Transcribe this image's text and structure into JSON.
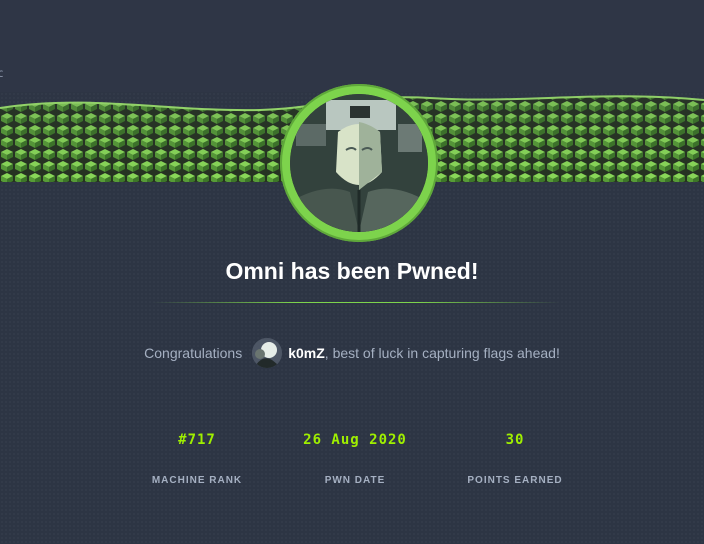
{
  "header": {
    "corner_text": "C"
  },
  "banner": {
    "accent_color": "#7dd34c",
    "avatar_icon": "robot-face-icon"
  },
  "title": "Omni has been Pwned!",
  "message": {
    "prefix": "Congratulations",
    "username": "k0mZ",
    "suffix": ", best of luck in capturing flags ahead!"
  },
  "stats": [
    {
      "value": "#717",
      "label": "MACHINE RANK"
    },
    {
      "value": "26 Aug 2020",
      "label": "PWN DATE"
    },
    {
      "value": "30",
      "label": "POINTS EARNED"
    }
  ],
  "colors": {
    "background": "#2d3544",
    "accent_green": "#9fef00"
  }
}
